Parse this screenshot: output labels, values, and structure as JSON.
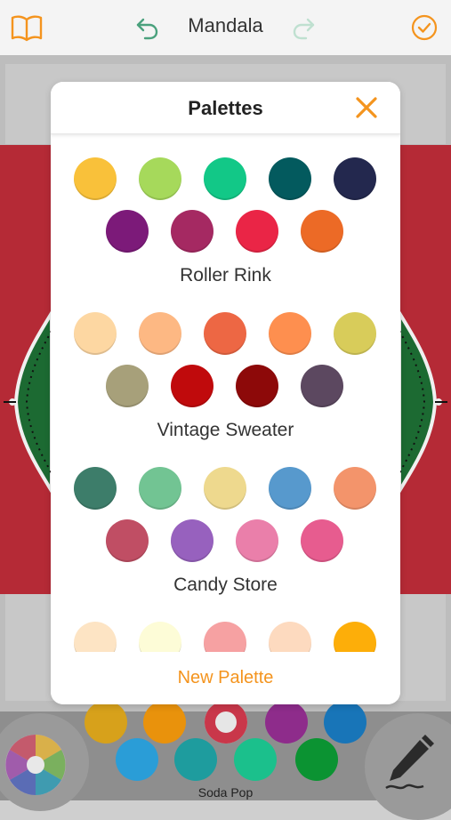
{
  "header": {
    "title": "Mandala"
  },
  "modal": {
    "title": "Palettes",
    "new_palette_label": "New Palette",
    "palettes": [
      {
        "name": "Roller Rink",
        "row1": [
          "#f9c13a",
          "#a6d95b",
          "#12c887",
          "#035a5e",
          "#23284e"
        ],
        "row2": [
          "#7c1a79",
          "#a52962",
          "#ea2546",
          "#ec6a26"
        ]
      },
      {
        "name": "Vintage Sweater",
        "row1": [
          "#fdd7a2",
          "#fdb883",
          "#ed6744",
          "#fe8f4f",
          "#d8cc5a"
        ],
        "row2": [
          "#a7a07a",
          "#c00a0c",
          "#8d0909",
          "#5c4860"
        ]
      },
      {
        "name": "Candy Store",
        "row1": [
          "#3d7d6a",
          "#72c493",
          "#eed98e",
          "#5799cd",
          "#f3946b"
        ],
        "row2": [
          "#c04e64",
          "#9761be",
          "#ea7faa",
          "#e75c8f"
        ]
      },
      {
        "name": "",
        "row1": [
          "#fde4c4",
          "#fdfcd7",
          "#f6a1a2",
          "#fddabf",
          "#fdae09"
        ],
        "row2": []
      }
    ]
  },
  "bottom_bar": {
    "palette_name": "Soda Pop",
    "row1": [
      "#d7a11b",
      "#e9920c",
      "#c9374a",
      "#8e2c8b",
      "#1875b8"
    ],
    "row2": [
      "#2a9dd7",
      "#1e9c9e",
      "#1bc08c",
      "#0b9332"
    ]
  },
  "icons": {
    "book": "book-icon",
    "undo": "undo-arrow-icon",
    "redo": "redo-arrow-icon",
    "done": "checkmark-circle-icon",
    "close": "close-x-icon",
    "wheel": "color-wheel-icon",
    "pen": "pen-icon"
  },
  "colors": {
    "accent": "#f4941e"
  }
}
